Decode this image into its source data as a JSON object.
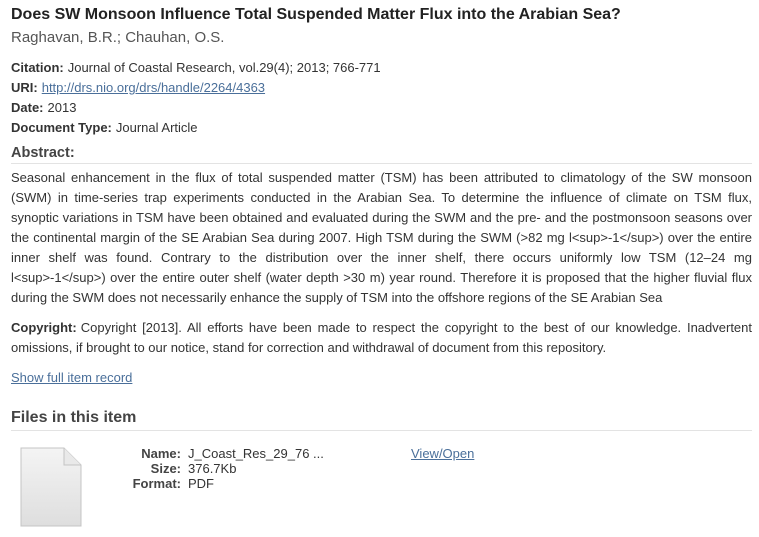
{
  "record": {
    "title": "Does SW Monsoon Influence Total Suspended Matter Flux into the Arabian Sea?",
    "authors": "Raghavan, B.R.; Chauhan, O.S."
  },
  "metadata": {
    "citation_label": "Citation:",
    "citation_value": "Journal of Coastal Research, vol.29(4); 2013; 766-771",
    "uri_label": "URI:",
    "uri_value": "http://drs.nio.org/drs/handle/2264/4363",
    "date_label": "Date:",
    "date_value": "2013",
    "doctype_label": "Document Type:",
    "doctype_value": "Journal Article"
  },
  "abstract": {
    "heading": "Abstract:",
    "text": "Seasonal enhancement in the flux of total suspended matter (TSM) has been attributed to climatology of the SW monsoon (SWM) in time-series trap experiments conducted in the Arabian Sea. To determine the influence of climate on TSM flux, synoptic variations in TSM have been obtained and evaluated during the SWM and the pre- and the postmonsoon seasons over the continental margin of the SE Arabian Sea during 2007. High TSM during the SWM (>82 mg l<sup>-1</sup>) over the entire inner shelf was found. Contrary to the distribution over the inner shelf, there occurs uniformly low TSM (12–24 mg l<sup>-1</sup>) over the entire outer shelf (water depth >30 m) year round. Therefore it is proposed that the higher fluvial flux during the SWM does not necessarily enhance the supply of TSM into the offshore regions of the SE Arabian Sea"
  },
  "copyright": {
    "label": "Copyright:",
    "text": "Copyright [2013]. All efforts have been made to respect the copyright to the best of our knowledge. Inadvertent omissions, if brought to our notice, stand for correction and withdrawal of document from this repository."
  },
  "links": {
    "full_record": "Show full item record"
  },
  "files": {
    "heading": "Files in this item",
    "name_label": "Name:",
    "name_value": "J_Coast_Res_29_76 ...",
    "size_label": "Size:",
    "size_value": "376.7Kb",
    "format_label": "Format:",
    "format_value": "PDF",
    "view_link": "View/Open",
    "thumbnail_icon": "document-file-icon"
  }
}
